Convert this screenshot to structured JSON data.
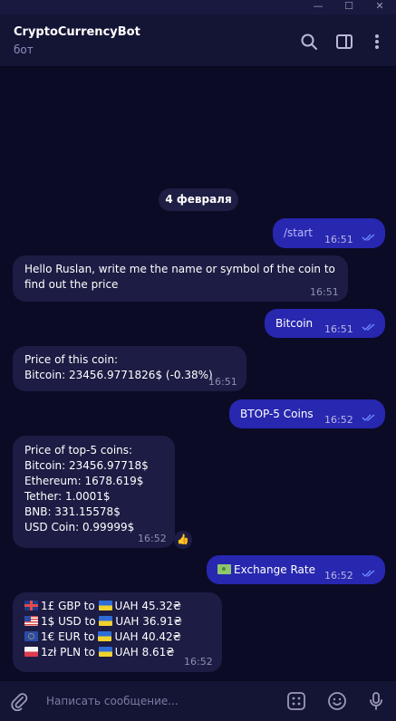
{
  "window": {
    "minimize_glyph": "—",
    "maximize_glyph": "☐",
    "close_glyph": "✕"
  },
  "header": {
    "title": "CryptoCurrencyBot",
    "subtitle": "бот"
  },
  "chat": {
    "date": "4 февраля",
    "messages": [
      {
        "dir": "out",
        "text": "/start",
        "time": "16:51"
      },
      {
        "dir": "in",
        "lines": [
          "Hello Ruslan, write me the name or symbol of the coin to",
          "find out the price"
        ],
        "time": "16:51"
      },
      {
        "dir": "out",
        "text": "Bitcoin",
        "time": "16:51"
      },
      {
        "dir": "in",
        "lines": [
          "Price of this coin:",
          "Bitcoin: 23456.9771826$ (-0.38%)"
        ],
        "time": "16:51"
      },
      {
        "dir": "out",
        "text": "ВTOP-5 Coins",
        "time": "16:52"
      },
      {
        "dir": "in",
        "lines": [
          "Price of top-5 coins:",
          "Bitcoin: 23456.97718$",
          "Ethereum: 1678.619$",
          "Tether: 1.0001$",
          "BNB: 331.15578$",
          "USD Coin: 0.99999$"
        ],
        "time": "16:52",
        "reaction": "👍"
      },
      {
        "dir": "out",
        "text": "Exchange Rate",
        "icon": "money-icon",
        "time": "16:52"
      },
      {
        "dir": "in",
        "rates": [
          {
            "from_flag": "gb-flag",
            "from": "1£ GBP to",
            "to_flag": "ua-flag",
            "to": "UAH 45.32₴"
          },
          {
            "from_flag": "us-flag",
            "from": "1$ USD to",
            "to_flag": "ua-flag",
            "to": "UAH 36.91₴"
          },
          {
            "from_flag": "eu-flag",
            "from": "1€ EUR to",
            "to_flag": "ua-flag",
            "to": "UAH 40.42₴"
          },
          {
            "from_flag": "pl-flag",
            "from": "1zł PLN to",
            "to_flag": "ua-flag",
            "to": "UAH 8.61₴"
          }
        ],
        "time": "16:52"
      }
    ]
  },
  "composer": {
    "placeholder": "Написать сообщение..."
  },
  "colors": {
    "background": "#0a0a25",
    "header": "#141435",
    "outgoing_bubble": "#2727b0",
    "incoming_bubble": "#1c1c44",
    "read_ticks": "#6f8cff"
  },
  "icons": [
    "search-icon",
    "sidebar-icon",
    "more-icon",
    "attach-icon",
    "bot-commands-icon",
    "emoji-icon",
    "microphone-icon"
  ]
}
